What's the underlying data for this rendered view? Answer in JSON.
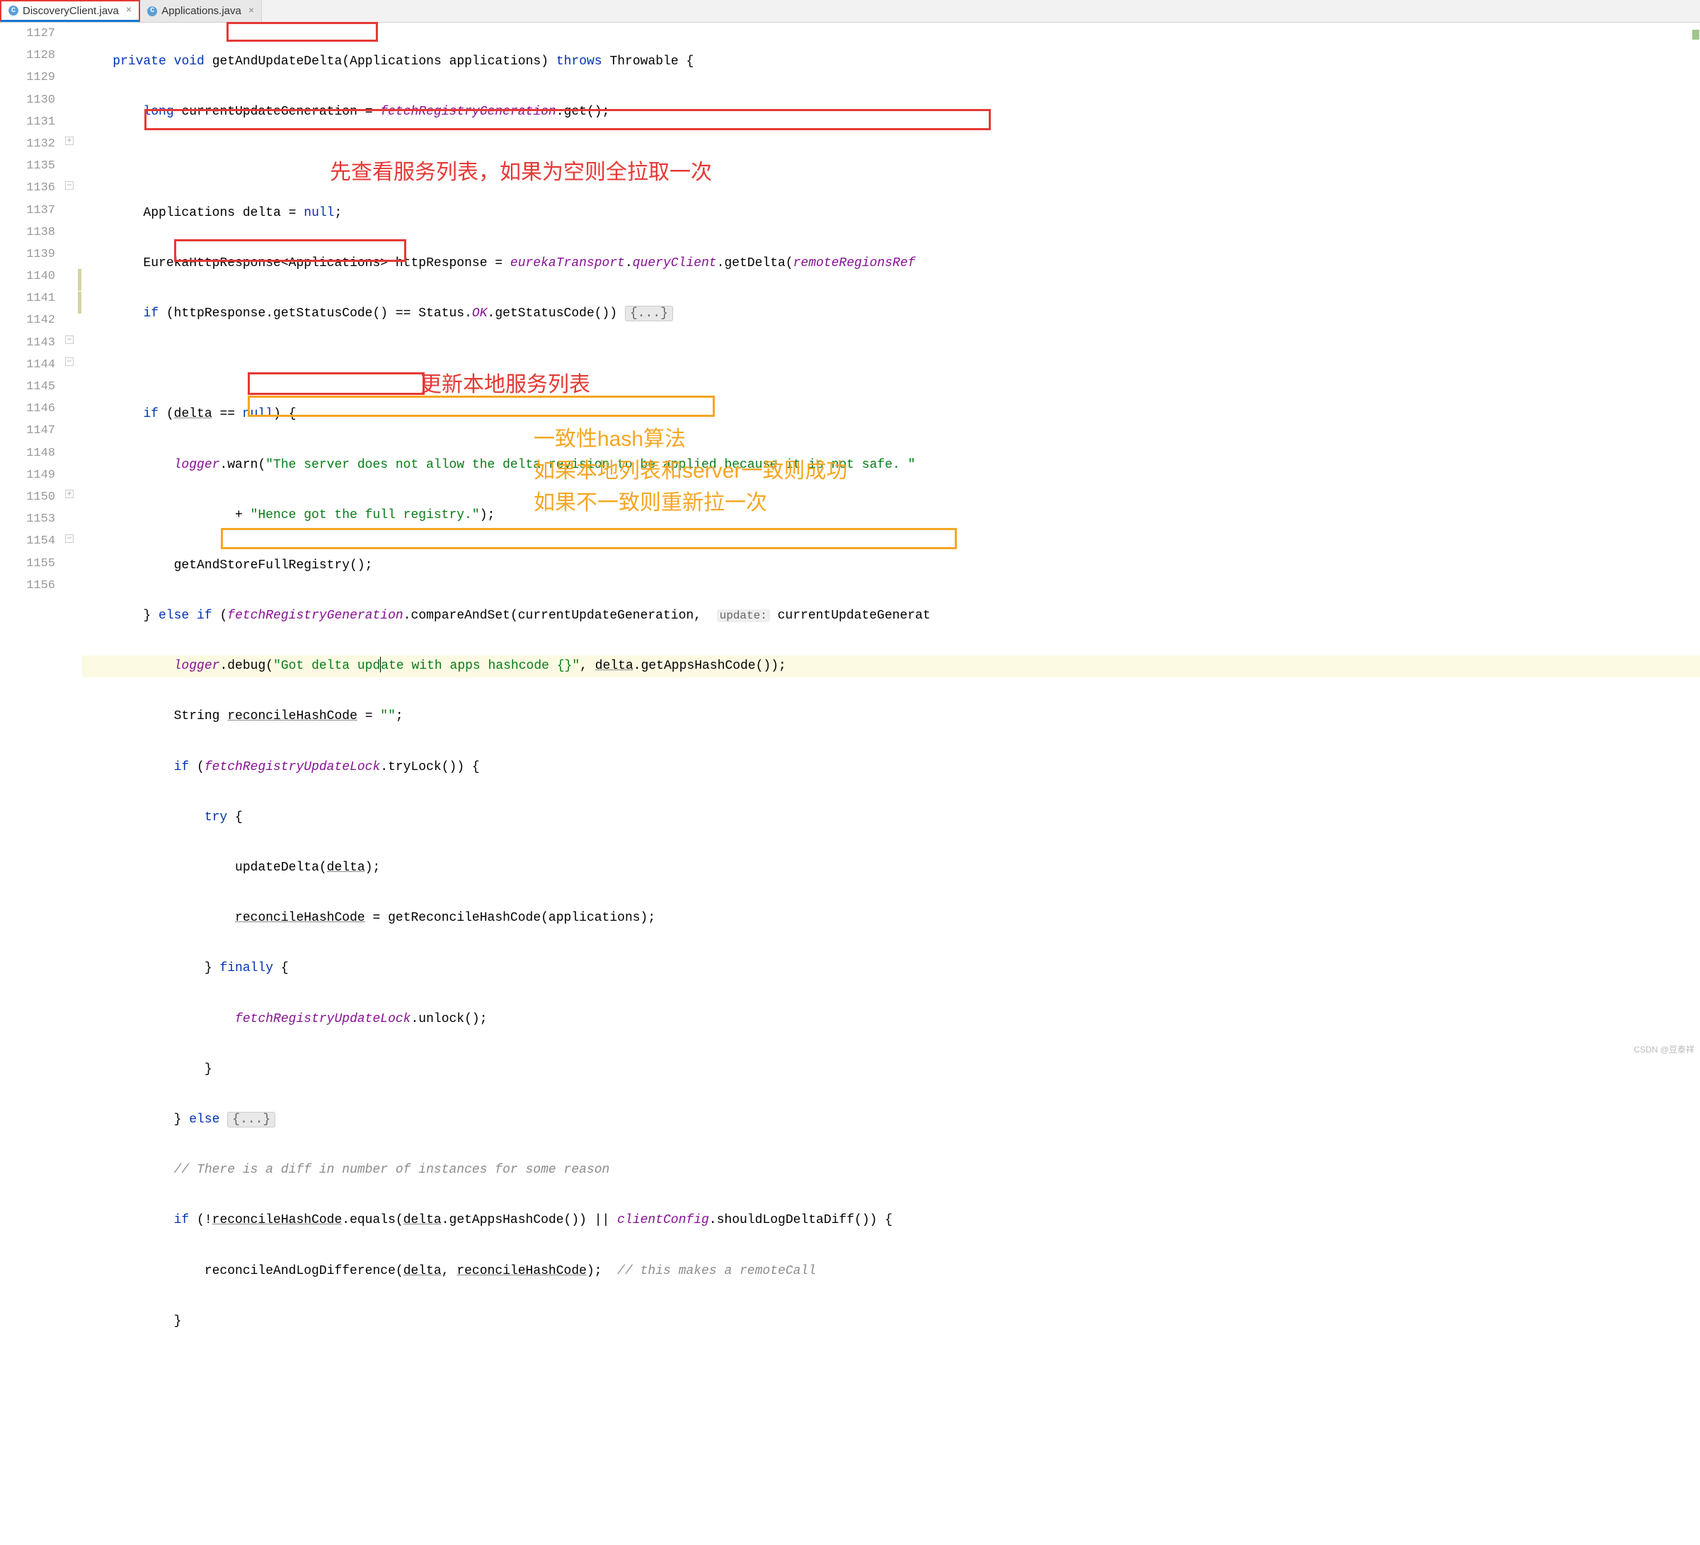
{
  "tabs": [
    {
      "label": "DiscoveryClient.java",
      "active": true
    },
    {
      "label": "Applications.java",
      "active": false
    }
  ],
  "gutter_lines": [
    "1127",
    "1128",
    "1129",
    "1130",
    "1131",
    "1132",
    "1135",
    "1136",
    "1137",
    "1138",
    "1139",
    "1140",
    "1141",
    "1142",
    "1143",
    "1144",
    "1145",
    "1146",
    "1147",
    "1148",
    "1149",
    "1150",
    "1153",
    "1154",
    "1155",
    "1156"
  ],
  "code": {
    "l1127": {
      "kw1": "private",
      "kw2": "void",
      "method": "getAndUpdateDelta",
      "paren_open": "(",
      "type": "Applications ",
      "param": "applications",
      "paren_close": ") ",
      "throws": "throws",
      "space": " ",
      "throw_type": "Throwable {"
    },
    "l1128": {
      "indent": "        ",
      "kw": "long",
      "sp": " ",
      "ident": "currentUpdateGeneration = ",
      "field": "fetchRegistryGeneration",
      "rest": ".get();"
    },
    "l1129": {
      "blank": " "
    },
    "l1130": {
      "indent": "        ",
      "type": "Applications ",
      "ident": "delta = ",
      "kw": "null",
      "semi": ";"
    },
    "l1131": {
      "indent": "        ",
      "part1": "EurekaHttpResponse<Applications> httpResponse = ",
      "field1": "eurekaTransport",
      "dot1": ".",
      "field2": "queryClient",
      "dot2": ".getDelta(",
      "field3": "remoteRegionsRef"
    },
    "l1132": {
      "indent": "        ",
      "kw": "if",
      "cond": " (httpResponse.getStatusCode() == Status.",
      "ok": "OK",
      "rest": ".getStatusCode()) ",
      "fold": "{...}"
    },
    "l1135": {
      "blank": " "
    },
    "l1136": {
      "indent": "        ",
      "kw": "if",
      "open": " (",
      "delta": "delta",
      "rest": " == ",
      "null_kw": "null",
      "close": ") {"
    },
    "l1137": {
      "indent": "            ",
      "logger": "logger",
      "method": ".warn(",
      "str": "\"The server does not allow the delta revision to be applied because it is not safe. \""
    },
    "l1138": {
      "indent": "                    + ",
      "str": "\"Hence got the full registry.\"",
      "close": ");"
    },
    "l1139": {
      "indent": "            ",
      "call": "getAndStoreFullRegistry();"
    },
    "l1140": {
      "indent": "        } ",
      "kw": "else if",
      "open": " (",
      "field": "fetchRegistryGeneration",
      "rest": ".compareAndSet(currentUpdateGeneration,  ",
      "hint": "update:",
      "after": " currentUpdateGenerat"
    },
    "l1141": {
      "indent": "            ",
      "logger": "logger",
      "method": ".debug(",
      "str1": "\"Got delta upd",
      "str2": "ate with apps hashcode {}\"",
      "mid": ", ",
      "delta": "delta",
      "rest": ".getAppsHashCode());"
    },
    "l1142": {
      "indent": "            ",
      "type": "String ",
      "var": "reconcileHashCode",
      "rest": " = ",
      "str": "\"\"",
      "semi": ";"
    },
    "l1143": {
      "indent": "            ",
      "kw": "if",
      "open": " (",
      "field": "fetchRegistryUpdateLock",
      "rest": ".tryLock()) {"
    },
    "l1144": {
      "indent": "                ",
      "kw": "try",
      "rest": " {"
    },
    "l1145": {
      "indent": "                    ",
      "call": "updateDelta(",
      "delta": "delta",
      "close": ");"
    },
    "l1146": {
      "indent": "                    ",
      "var": "reconcileHashCode",
      "rest": " = getReconcileHashCode(applications);"
    },
    "l1147": {
      "indent": "                } ",
      "kw": "finally",
      "rest": " {"
    },
    "l1148": {
      "indent": "                    ",
      "field": "fetchRegistryUpdateLock",
      "rest": ".unlock();"
    },
    "l1149": {
      "indent": "                }",
      "blank": ""
    },
    "l1150": {
      "indent": "            } ",
      "kw": "else",
      "sp": " ",
      "fold": "{...}"
    },
    "l1153": {
      "indent": "            ",
      "comment": "// There is a diff in number of instances for some reason"
    },
    "l1154": {
      "indent": "            ",
      "kw": "if",
      "open": " (!",
      "var": "reconcileHashCode",
      "mid": ".equals(",
      "delta": "delta",
      "rest1": ".getAppsHashCode()) || ",
      "field": "clientConfig",
      "rest2": ".shouldLogDeltaDiff()) {"
    },
    "l1155": {
      "indent": "                reconcileAndLogDifference(",
      "delta": "delta",
      "comma": ", ",
      "var": "reconcileHashCode",
      "close": ");  ",
      "comment": "// this makes a remoteCall"
    },
    "l1156": {
      "indent": "            }",
      "blank": ""
    }
  },
  "annotations": {
    "red1": "先查看服务列表，如果为空则全拉取一次",
    "red2": "更新本地服务列表",
    "orange1": "一致性hash算法",
    "orange2": "如果本地列表和server一致则成功",
    "orange3": "如果不一致则重新拉一次"
  },
  "watermark": "CSDN @豆泰祥"
}
